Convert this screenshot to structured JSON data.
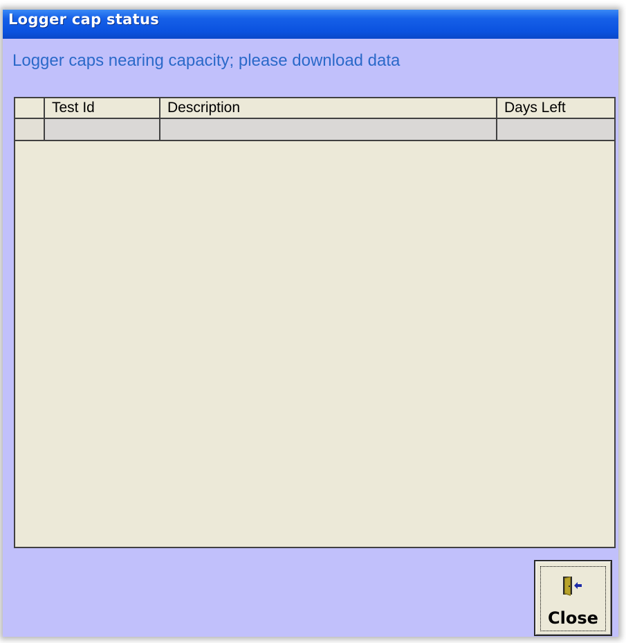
{
  "window": {
    "title": "Logger cap status"
  },
  "message": "Logger caps nearing capacity; please download data",
  "grid": {
    "columns": [
      "Test Id",
      "Description",
      "Days Left"
    ],
    "rows": [
      [
        "",
        "",
        ""
      ]
    ]
  },
  "close_button": {
    "label": "Close",
    "icon": "exit-door-icon"
  },
  "colors": {
    "title_bar": "#0b52df",
    "form_background": "#c1c0fb",
    "grid_background": "#ece9d8",
    "message_text": "#2b69c9"
  }
}
